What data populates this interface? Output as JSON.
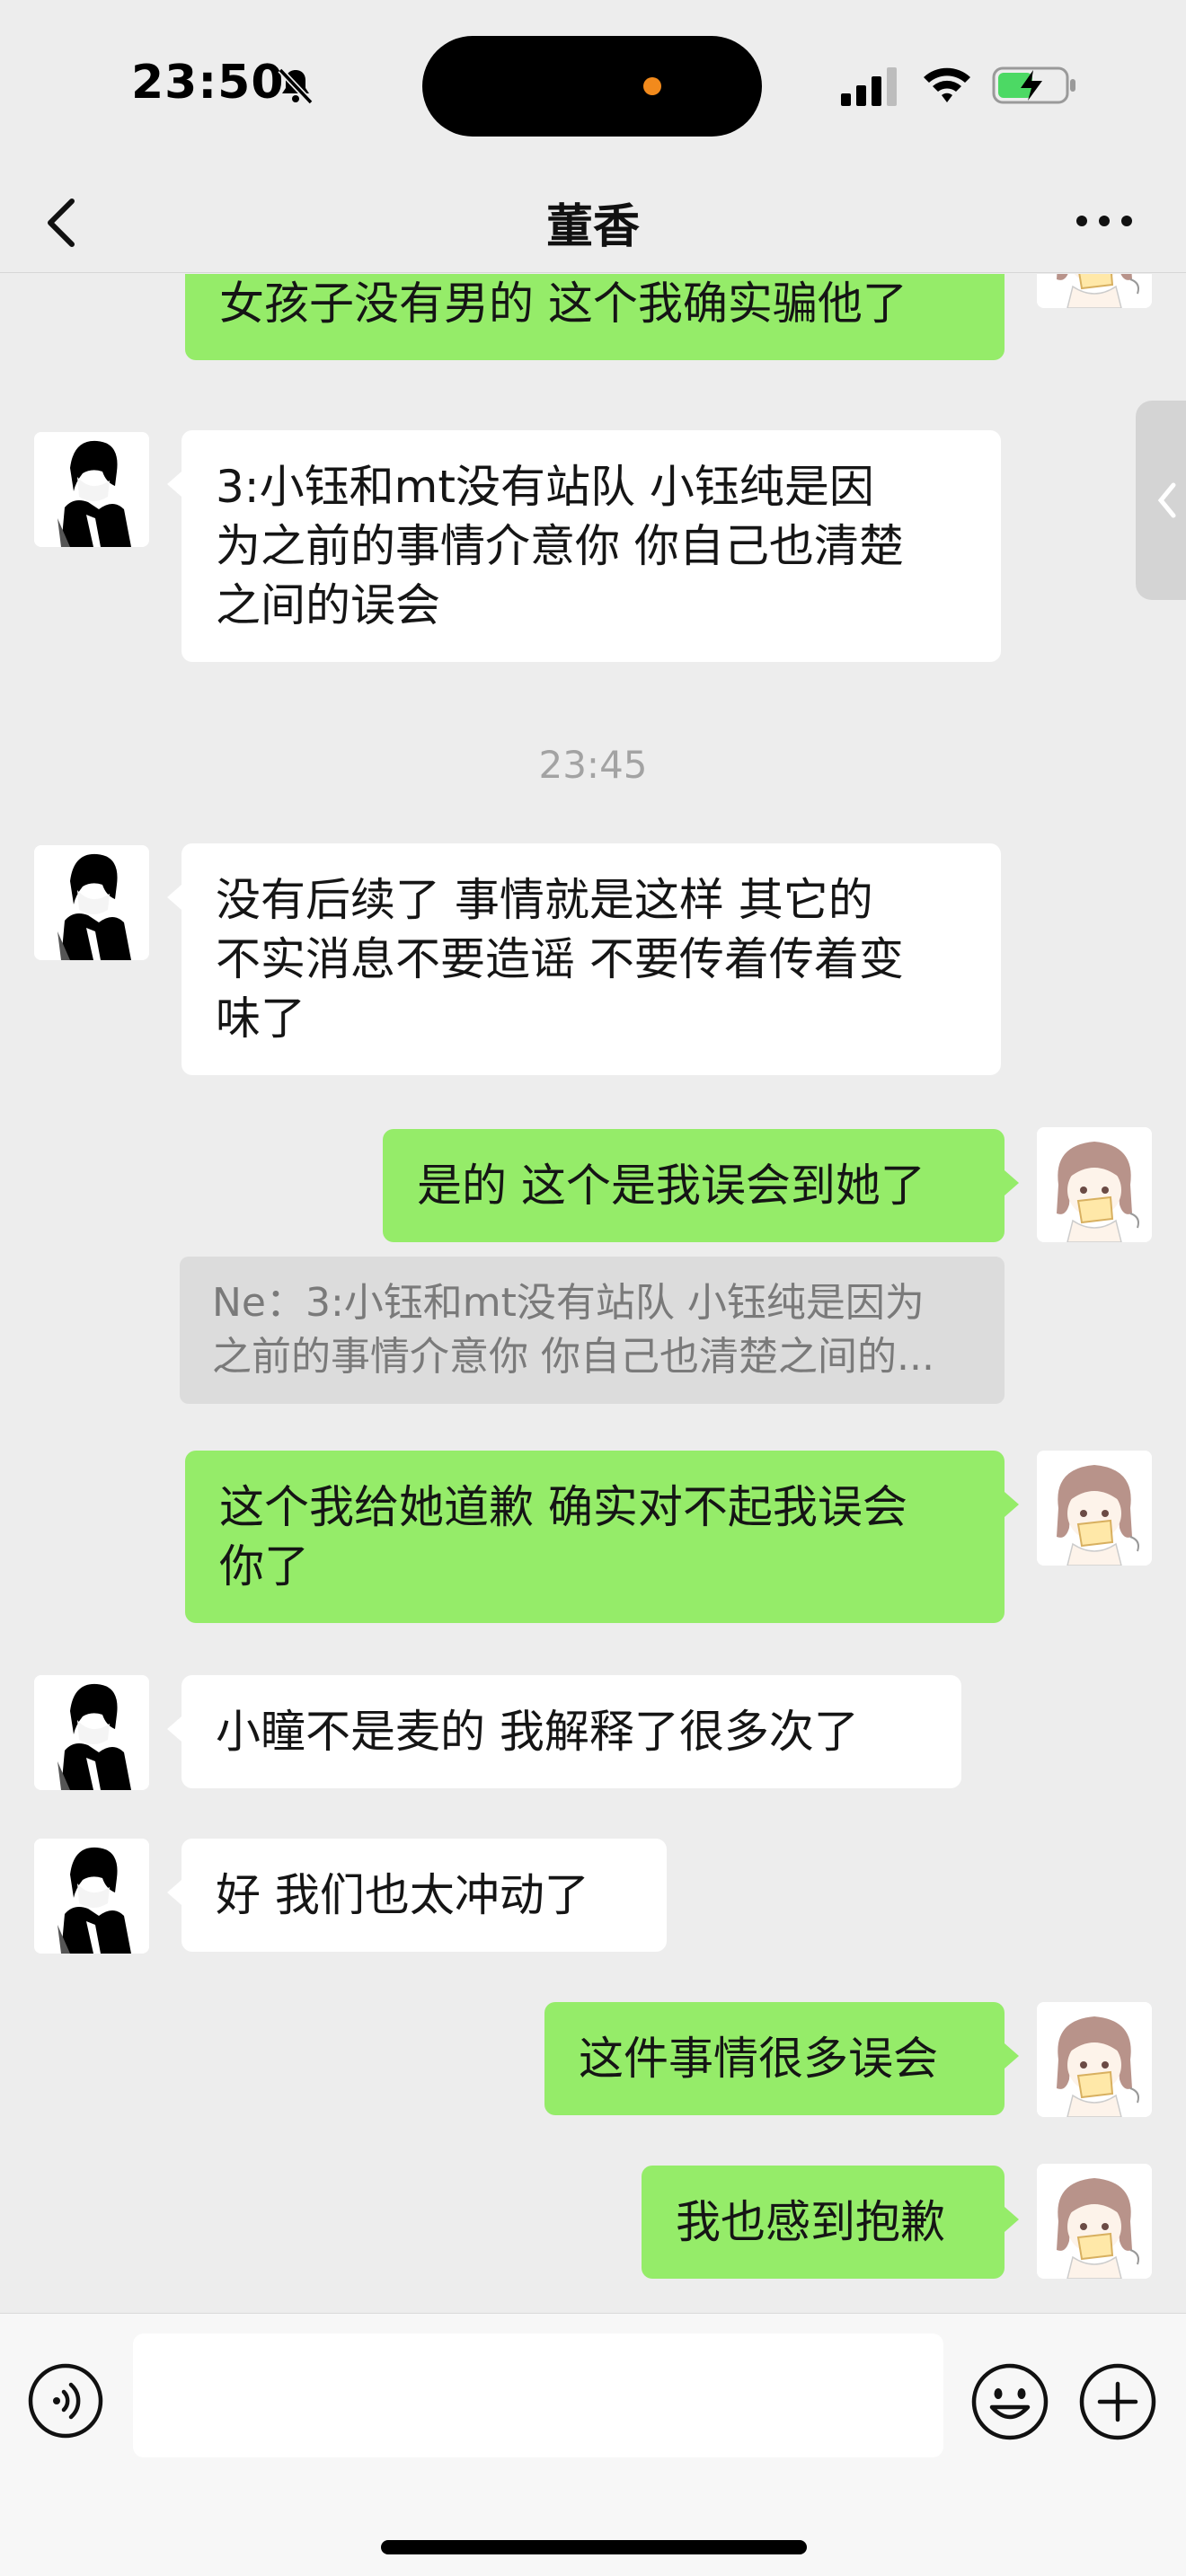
{
  "status_bar": {
    "time": "23:50"
  },
  "nav": {
    "title": "董香"
  },
  "messages": [
    {
      "side": "out",
      "text": "对的 当时是因为怕他说我才说只有\n女孩子没有男的 这个我确实骗他了"
    },
    {
      "side": "in",
      "text": "3:小钰和mt没有站队 小钰纯是因\n为之前的事情介意你 你自己也清楚\n之间的误会"
    },
    {
      "type": "timestamp",
      "text": "23:45"
    },
    {
      "side": "in",
      "text": "没有后续了 事情就是这样 其它的\n不实消息不要造谣 不要传着传着变\n味了"
    },
    {
      "side": "out",
      "text": "是的 这个是我误会到她了"
    },
    {
      "type": "quote",
      "line1": "Ne：3:小钰和mt没有站队 小钰纯是因为",
      "line2": "之前的事情介意你 你自己也清楚之间的..."
    },
    {
      "side": "out",
      "text": "这个我给她道歉 确实对不起我误会\n你了"
    },
    {
      "side": "in",
      "text": "小瞳不是麦的 我解释了很多次了"
    },
    {
      "side": "in",
      "text": "好 我们也太冲动了"
    },
    {
      "side": "out",
      "text": "这件事情很多误会"
    },
    {
      "side": "out",
      "text": "我也感到抱歉"
    }
  ],
  "input_bar": {
    "value": ""
  },
  "colors": {
    "bubble_out": "#95ec69",
    "bubble_in": "#ffffff",
    "background": "#ededed"
  },
  "icons": [
    "bell-slash-icon",
    "signal-icon",
    "wifi-icon",
    "battery-charging-icon",
    "back-chevron-icon",
    "more-icon",
    "voice-icon",
    "emoji-icon",
    "plus-icon",
    "side-tab-chevron-icon"
  ]
}
